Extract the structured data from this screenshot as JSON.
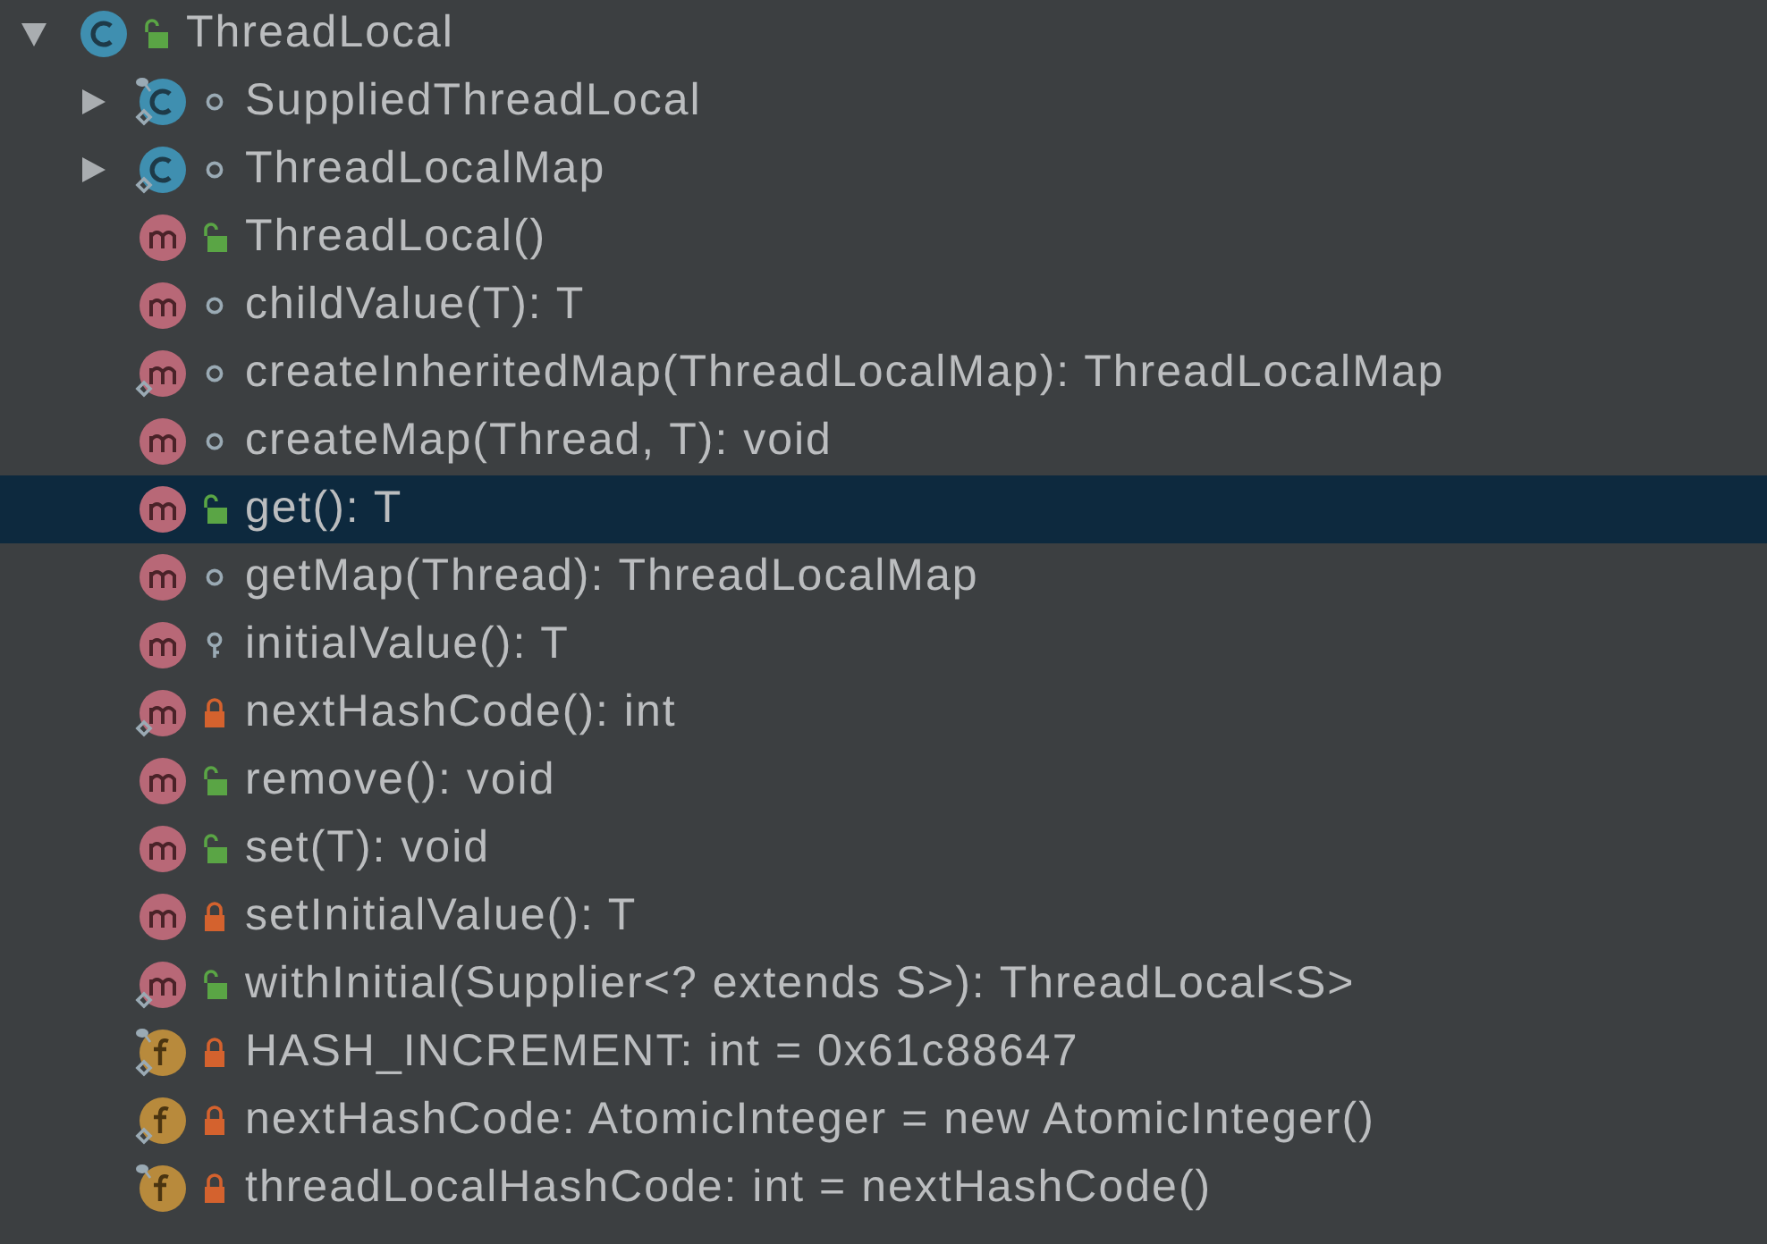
{
  "tree": {
    "label": "ThreadLocal",
    "kind": "class",
    "access": {
      "kind": "public"
    },
    "static": false,
    "final": false,
    "expanded": true,
    "selected": false,
    "children": [
      {
        "label": "SuppliedThreadLocal",
        "kind": "class",
        "access": {
          "kind": "package"
        },
        "static": true,
        "final": true,
        "expanded": false,
        "selected": false
      },
      {
        "label": "ThreadLocalMap",
        "kind": "class",
        "access": {
          "kind": "package"
        },
        "static": true,
        "final": false,
        "expanded": false,
        "selected": false
      },
      {
        "label": "ThreadLocal()",
        "kind": "method",
        "access": {
          "kind": "public"
        },
        "static": false,
        "final": false,
        "selected": false
      },
      {
        "label": "childValue(T): T",
        "kind": "method",
        "access": {
          "kind": "package"
        },
        "static": false,
        "final": false,
        "selected": false
      },
      {
        "label": "createInheritedMap(ThreadLocalMap): ThreadLocalMap",
        "kind": "method",
        "access": {
          "kind": "package"
        },
        "static": true,
        "final": false,
        "selected": false
      },
      {
        "label": "createMap(Thread, T): void",
        "kind": "method",
        "access": {
          "kind": "package"
        },
        "static": false,
        "final": false,
        "selected": false
      },
      {
        "label": "get(): T",
        "kind": "method",
        "access": {
          "kind": "public"
        },
        "static": false,
        "final": false,
        "selected": true
      },
      {
        "label": "getMap(Thread): ThreadLocalMap",
        "kind": "method",
        "access": {
          "kind": "package"
        },
        "static": false,
        "final": false,
        "selected": false
      },
      {
        "label": "initialValue(): T",
        "kind": "method",
        "access": {
          "kind": "protected"
        },
        "static": false,
        "final": false,
        "selected": false
      },
      {
        "label": "nextHashCode(): int",
        "kind": "method",
        "access": {
          "kind": "private"
        },
        "static": true,
        "final": false,
        "selected": false
      },
      {
        "label": "remove(): void",
        "kind": "method",
        "access": {
          "kind": "public"
        },
        "static": false,
        "final": false,
        "selected": false
      },
      {
        "label": "set(T): void",
        "kind": "method",
        "access": {
          "kind": "public"
        },
        "static": false,
        "final": false,
        "selected": false
      },
      {
        "label": "setInitialValue(): T",
        "kind": "method",
        "access": {
          "kind": "private"
        },
        "static": false,
        "final": false,
        "selected": false
      },
      {
        "label": "withInitial(Supplier<? extends S>): ThreadLocal<S>",
        "kind": "method",
        "access": {
          "kind": "public"
        },
        "static": true,
        "final": false,
        "selected": false
      },
      {
        "label": "HASH_INCREMENT: int = 0x61c88647",
        "kind": "field",
        "access": {
          "kind": "private"
        },
        "static": true,
        "final": true,
        "selected": false
      },
      {
        "label": "nextHashCode: AtomicInteger = new AtomicInteger()",
        "kind": "field",
        "access": {
          "kind": "private"
        },
        "static": true,
        "final": false,
        "selected": false
      },
      {
        "label": "threadLocalHashCode: int = nextHashCode()",
        "kind": "field",
        "access": {
          "kind": "private"
        },
        "static": false,
        "final": true,
        "selected": false
      }
    ]
  }
}
